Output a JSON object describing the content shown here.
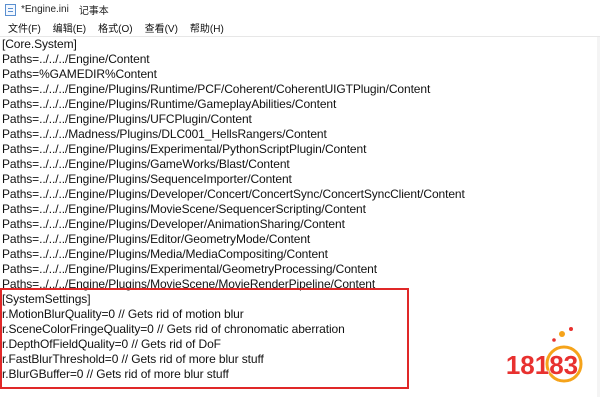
{
  "window": {
    "title": "*Engine.ini",
    "app_name": "记事本"
  },
  "menu": [
    "文件(F)",
    "编辑(E)",
    "格式(O)",
    "查看(V)",
    "帮助(H)"
  ],
  "editor": {
    "lines": [
      "[Core.System]",
      "Paths=../../../Engine/Content",
      "Paths=%GAMEDIR%Content",
      "Paths=../../../Engine/Plugins/Runtime/PCF/Coherent/CoherentUIGTPlugin/Content",
      "Paths=../../../Engine/Plugins/Runtime/GameplayAbilities/Content",
      "Paths=../../../Engine/Plugins/UFCPlugin/Content",
      "Paths=../../../Madness/Plugins/DLC001_HellsRangers/Content",
      "Paths=../../../Engine/Plugins/Experimental/PythonScriptPlugin/Content",
      "Paths=../../../Engine/Plugins/GameWorks/Blast/Content",
      "Paths=../../../Engine/Plugins/SequenceImporter/Content",
      "Paths=../../../Engine/Plugins/Developer/Concert/ConcertSync/ConcertSyncClient/Content",
      "Paths=../../../Engine/Plugins/MovieScene/SequencerScripting/Content",
      "Paths=../../../Engine/Plugins/Developer/AnimationSharing/Content",
      "Paths=../../../Engine/Plugins/Editor/GeometryMode/Content",
      "Paths=../../../Engine/Plugins/Media/MediaCompositing/Content",
      "Paths=../../../Engine/Plugins/Experimental/GeometryProcessing/Content",
      "Paths=../../../Engine/Plugins/MovieScene/MovieRenderPipeline/Content",
      "[SystemSettings]",
      "r.MotionBlurQuality=0 // Gets rid of motion blur",
      "r.SceneColorFringeQuality=0 // Gets rid of chronomatic aberration",
      "r.DepthOfFieldQuality=0 // Gets rid of DoF",
      "r.FastBlurThreshold=0 // Gets rid of more blur stuff",
      "r.BlurGBuffer=0 // Gets rid of more blur stuff"
    ]
  },
  "watermark": {
    "text": "18183"
  },
  "colors": {
    "highlight_border": "#e02828",
    "logo_red": "#e8312f",
    "logo_orange": "#f5a31a"
  }
}
